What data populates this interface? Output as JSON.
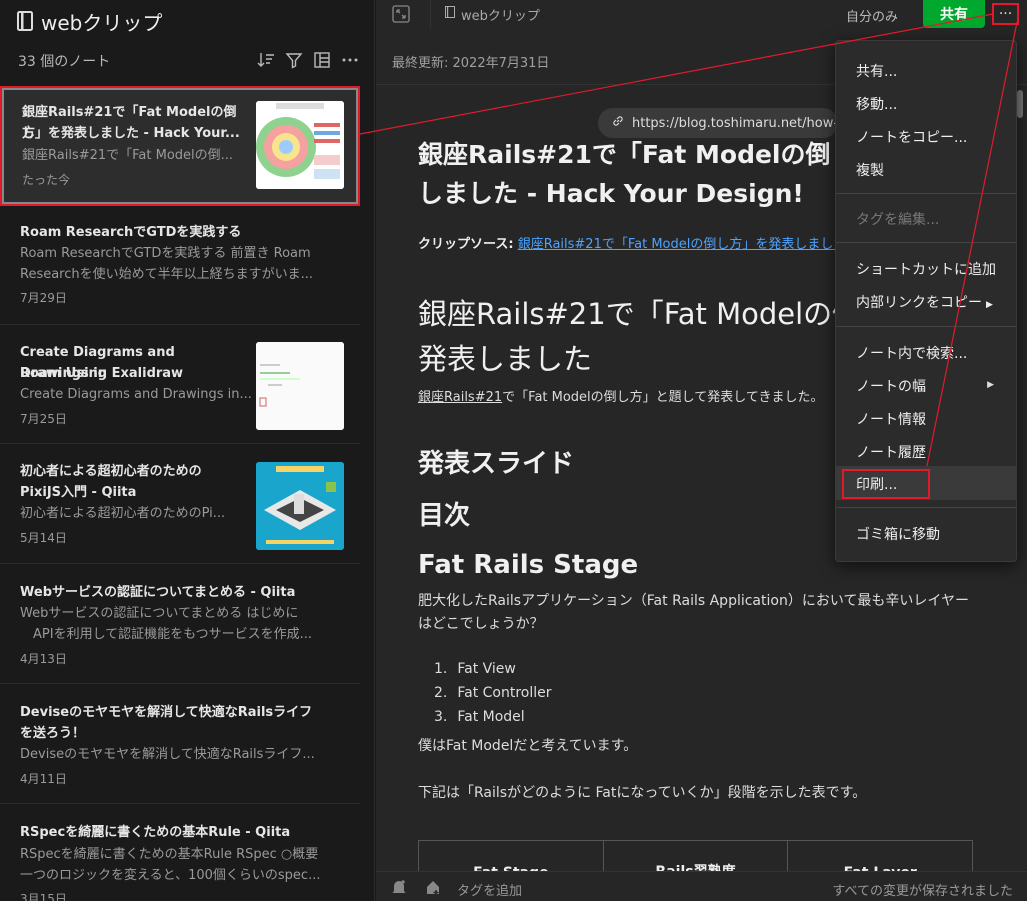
{
  "left": {
    "title": "webクリップ",
    "note_count": "33 個のノート",
    "notes": [
      {
        "title": "銀座Rails#21で「Fat Modelの倒し方」を発表しました - Hack Your...",
        "title1": "銀座Rails#21で「Fat Modelの倒し",
        "title2": "方」を発表しました - Hack Your...",
        "snippet": "銀座Rails#21で「Fat Modelの倒...",
        "date": "たった今"
      },
      {
        "title1": "Roam ResearchでGTDを実践する",
        "snippet1": "Roam ResearchでGTDを実践する 前置き Roam",
        "snippet2": "Researchを使い始めて半年以上経ちますがいま...",
        "date": "7月29日"
      },
      {
        "title1": "Create Diagrams and Drawings in",
        "title2": "Roam Using Exalidraw",
        "snippet1": "Create Diagrams and Drawings in...",
        "date": "7月25日"
      },
      {
        "title1": "初心者による超初心者のための",
        "title2": "PixiJS入門 - Qiita",
        "snippet1": "初心者による超初心者のためのPi...",
        "date": "5月14日"
      },
      {
        "title1": "Webサービスの認証についてまとめる - Qiita",
        "snippet1": "Webサービスの認証についてまとめる はじめに",
        "snippet2": "　APIを利用して認証機能をもつサービスを作成...",
        "date": "4月13日"
      },
      {
        "title1": "DeviseのモヤモヤをRails解消して快適なRailsライフ",
        "title1x": "Deviseのモヤモヤを解消して快適なRailsライフ",
        "title2": "を送ろう！",
        "snippet1": "Deviseのモヤモヤを解消して快適なRailsライフ...",
        "date": "4月11日"
      },
      {
        "title1": "RSpecを綺麗に書くための基本Rule - Qiita",
        "snippet1": "RSpecを綺麗に書くための基本Rule RSpec ○概要",
        "snippet2": "一つのロジックを変えると、100個くらいのspec...",
        "date": "3月15日"
      }
    ]
  },
  "topbar": {
    "notebook": "webクリップ",
    "visibility": "自分のみ",
    "share": "共有",
    "more": "···"
  },
  "content": {
    "updated": "最終更新: 2022年7月31日",
    "url": "https://blog.toshimaru.net/how-to-d",
    "h1a_line1": "銀座Rails#21で「Fat Modelの倒し方",
    "h1a_line2": "しました - Hack Your Design!",
    "clip_label": "クリップソース:",
    "clip_link": "銀座Rails#21で「Fat Modelの倒し方」を発表しました",
    "h1b_line1": "銀座Rails#21で「Fat Modelの倒",
    "h1b_line2": "発表しました",
    "intro_link": "銀座Rails#21",
    "intro_rest": "で「Fat Modelの倒し方」と題して発表してきました。",
    "h2_slides": "発表スライド",
    "h2_toc": "目次",
    "h2_stage": "Fat Rails Stage",
    "p1": "肥大化したRailsアプリケーション（Fat Rails Application）において最も辛いレイヤーはどこでしょうか？",
    "list": [
      {
        "num": "1.",
        "text": "Fat View"
      },
      {
        "num": "2.",
        "text": "Fat Controller"
      },
      {
        "num": "3.",
        "text": "Fat Model"
      }
    ],
    "p2": "僕はFat Modelだと考えています。",
    "p3": "下記は「Railsがどのように Fatになっていくか」段階を示した表です。",
    "table_headers": [
      "Fat Stage",
      "Rails習熟度",
      "Fat Layer"
    ]
  },
  "bottombar": {
    "add_tag": "タグを追加",
    "saved": "すべての変更が保存されました"
  },
  "menu": {
    "share": "共有...",
    "move": "移動...",
    "copy": "ノートをコピー...",
    "duplicate": "複製",
    "edit_tags": "タグを編集...",
    "add_shortcut": "ショートカットに追加",
    "copy_link": "内部リンクをコピー",
    "find": "ノート内で検索...",
    "width": "ノートの幅",
    "info": "ノート情報",
    "history": "ノート履歴",
    "print": "印刷...",
    "trash": "ゴミ箱に移動"
  }
}
